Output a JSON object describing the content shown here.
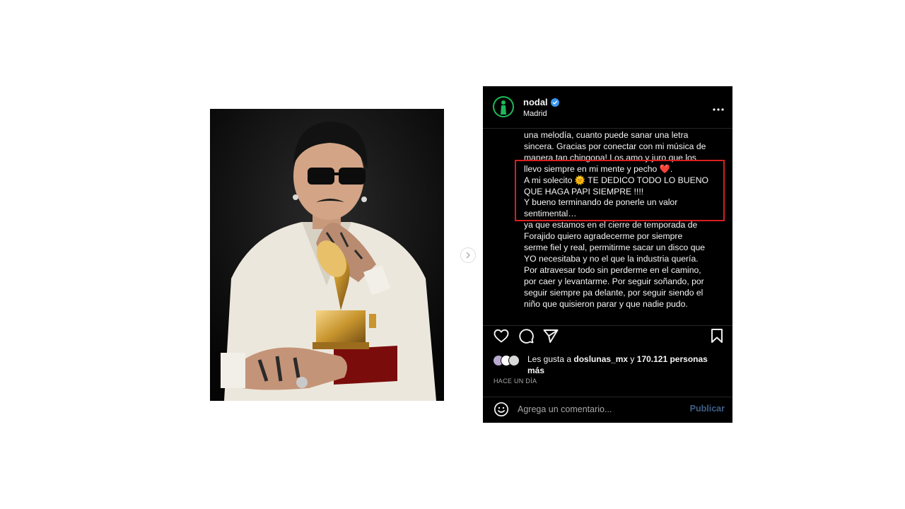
{
  "post": {
    "username": "nodal",
    "location": "Madrid",
    "caption_lines": [
      "una melodía, cuanto puede sanar una letra",
      "sincera. Gracias por conectar con mi música de",
      "manera tan chingona! Los amo y juro que los",
      "llevo siempre en mi mente y pecho ❤️.",
      "A mi solecito 🌞 TE DEDICO TODO LO BUENO",
      "QUE HAGA PAPI SIEMPRE !!!!",
      "Y bueno terminando de ponerle un valor",
      "sentimental…",
      "ya que estamos en el cierre de temporada de",
      "Forajido quiero agradecerme por siempre",
      "serme fiel y real, permitirme sacar un disco que",
      "YO necesitaba y no el que la industria quería.",
      "Por atravesar todo sin perderme en el camino,",
      "por caer y levantarme. Por seguir soñando, por",
      "seguir siempre pa delante, por seguir siendo el",
      "niño que quisieron parar y que nadie pudo."
    ],
    "likes": {
      "prefix": "Les gusta a ",
      "user": "doslunas_mx",
      "connector": " y ",
      "count": "170.121 personas",
      "suffix": "más"
    },
    "time": "HACE UN DÍA",
    "comment_placeholder": "Agrega un comentario...",
    "publish_label": "Publicar"
  },
  "icons": {
    "more": "more-options-icon",
    "heart": "heart-icon",
    "comment": "comment-icon",
    "share": "share-icon",
    "save": "bookmark-icon",
    "emoji": "emoji-icon",
    "verified": "verified-badge-icon",
    "next": "chevron-right-icon"
  },
  "colors": {
    "panel_bg": "#000000",
    "highlight": "#d71f1f",
    "verified": "#3897f0",
    "avatar": "#1fb85a",
    "publish": "#3f5f86"
  }
}
